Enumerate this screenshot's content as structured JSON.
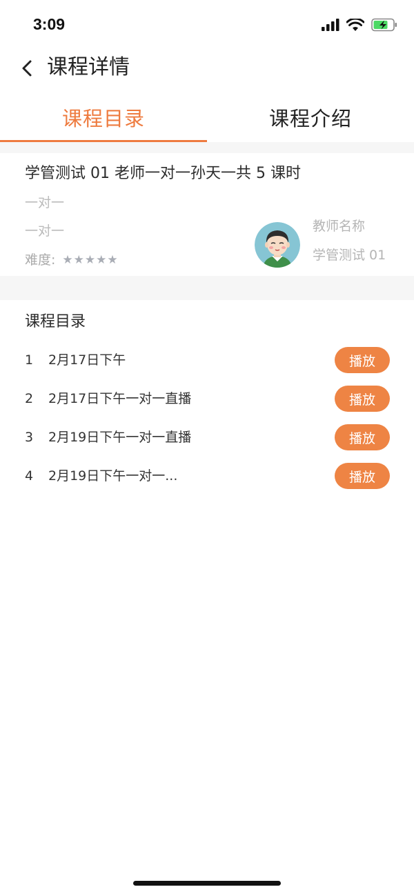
{
  "status_bar": {
    "time": "3:09"
  },
  "header": {
    "title": "课程详情"
  },
  "tabs": [
    {
      "label": "课程目录",
      "active": true
    },
    {
      "label": "课程介绍",
      "active": false
    }
  ],
  "course": {
    "title": "学管测试 01 老师一对一孙天一共 5 课时",
    "line1": "一对一",
    "line2": "一对一",
    "difficulty_label": "难度:",
    "difficulty_stars": 5,
    "teacher_label": "教师名称",
    "teacher_name": "学管测试 01"
  },
  "catalog": {
    "title": "课程目录",
    "play_label": "播放",
    "lessons": [
      {
        "index": "1",
        "name": "2月17日下午"
      },
      {
        "index": "2",
        "name": "2月17日下午一对一直播"
      },
      {
        "index": "3",
        "name": "2月19日下午一对一直播"
      },
      {
        "index": "4",
        "name": "2月19日下午一对一..."
      }
    ]
  },
  "colors": {
    "accent": "#ee7b3f",
    "play_button": "#ee8444",
    "star": "#a9adb5",
    "muted_text": "#bbbbbb"
  },
  "icons": {
    "back": "chevron-left-icon",
    "signal": "cellular-signal-icon",
    "wifi": "wifi-icon",
    "battery": "battery-charging-icon",
    "avatar": "teacher-avatar"
  }
}
